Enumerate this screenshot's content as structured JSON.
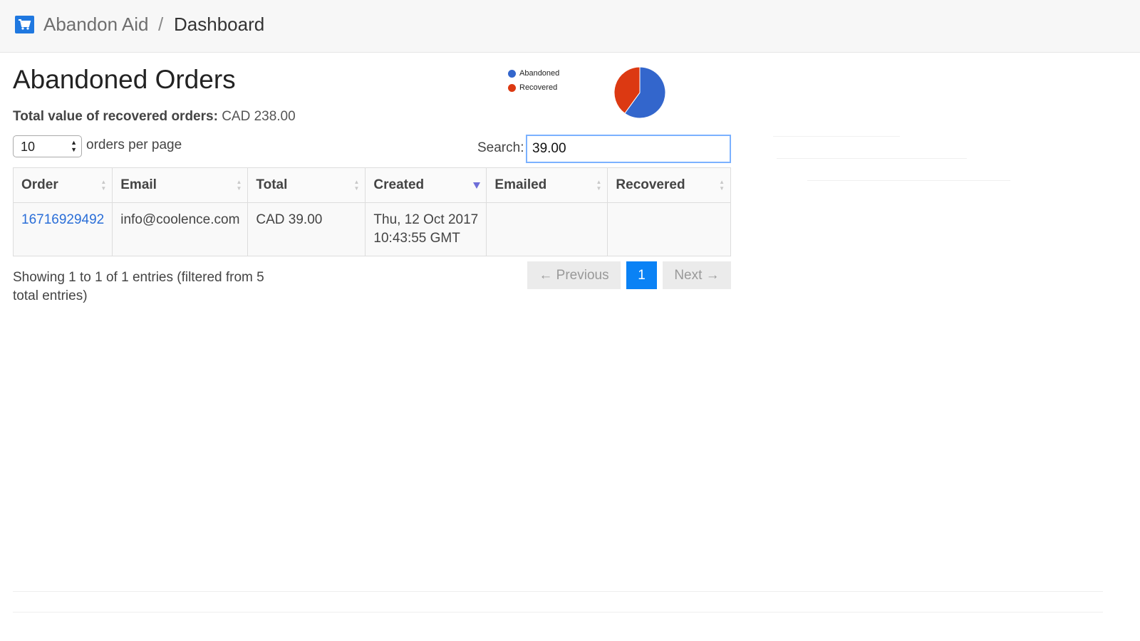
{
  "header": {
    "brand": "Abandon Aid",
    "separator": "/",
    "breadcrumb": "Dashboard"
  },
  "page": {
    "title": "Abandoned Orders",
    "total_label": "Total value of recovered orders:",
    "total_value": "CAD 238.00"
  },
  "chart_data": {
    "type": "pie",
    "legend_position": "left",
    "slices": [
      {
        "label": "Abandoned",
        "value": 0.6,
        "color": "#3366cc"
      },
      {
        "label": "Recovered",
        "value": 0.4,
        "color": "#dc3912"
      }
    ]
  },
  "controls": {
    "per_page_value": "10",
    "per_page_label": "orders per page",
    "search_label": "Search:",
    "search_value": "39.00"
  },
  "table": {
    "columns": [
      "Order",
      "Email",
      "Total",
      "Created",
      "Emailed",
      "Recovered"
    ],
    "rows": [
      {
        "order": "16716929492",
        "email": "info@coolence.com",
        "total": "CAD 39.00",
        "created_line1": "Thu, 12 Oct 2017",
        "created_line2": "10:43:55 GMT",
        "emailed": "",
        "recovered": ""
      }
    ]
  },
  "footer": {
    "info": "Showing 1 to 1 of 1 entries (filtered from 5 total entries)",
    "previous": "← Previous",
    "current_page": "1",
    "next": "Next →"
  },
  "colors": {
    "accent": "#0a82f5",
    "link": "#2a6ed8",
    "abandoned": "#3366cc",
    "recovered": "#dc3912"
  }
}
